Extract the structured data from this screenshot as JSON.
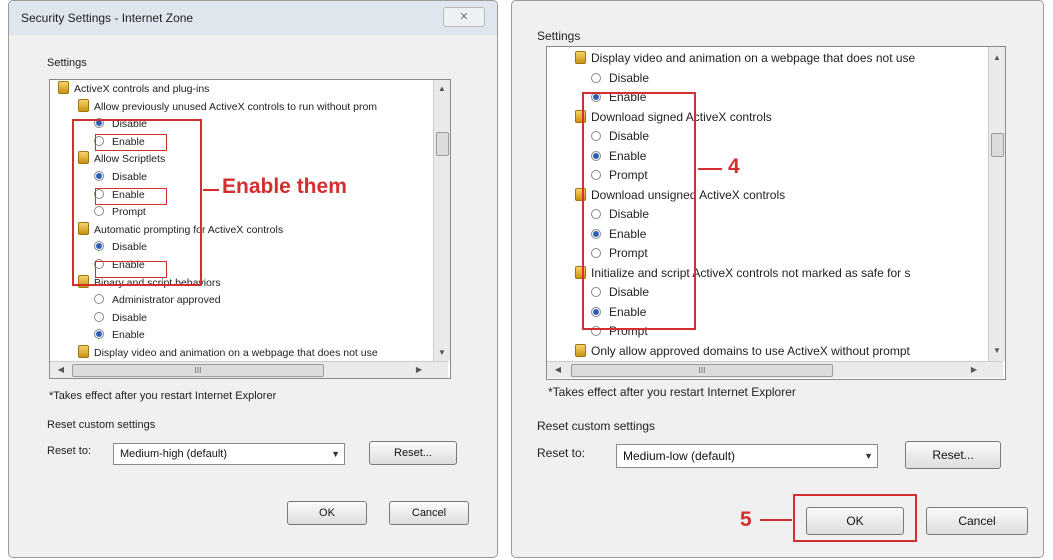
{
  "left_dialog": {
    "title": "Security Settings - Internet Zone",
    "close_glyph": "✕",
    "settings_label": "Settings",
    "items": [
      {
        "kind": "header",
        "text": "ActiveX controls and plug-ins"
      },
      {
        "kind": "item",
        "text": "Allow previously unused ActiveX controls to run without prom"
      },
      {
        "kind": "opt",
        "text": "Disable",
        "selected": true
      },
      {
        "kind": "opt",
        "text": "Enable",
        "selected": false
      },
      {
        "kind": "item",
        "text": "Allow Scriptlets"
      },
      {
        "kind": "opt",
        "text": "Disable",
        "selected": true
      },
      {
        "kind": "opt",
        "text": "Enable",
        "selected": false
      },
      {
        "kind": "opt",
        "text": "Prompt",
        "selected": false
      },
      {
        "kind": "item",
        "text": "Automatic prompting for ActiveX controls"
      },
      {
        "kind": "opt",
        "text": "Disable",
        "selected": true
      },
      {
        "kind": "opt",
        "text": "Enable",
        "selected": false
      },
      {
        "kind": "item",
        "text": "Binary and script behaviors"
      },
      {
        "kind": "opt",
        "text": "Administrator approved",
        "selected": false
      },
      {
        "kind": "opt",
        "text": "Disable",
        "selected": false
      },
      {
        "kind": "opt",
        "text": "Enable",
        "selected": true
      },
      {
        "kind": "item",
        "text": "Display video and animation on a webpage that does not use"
      }
    ],
    "hscroll_grip": "III",
    "note": "*Takes effect after you restart Internet Explorer",
    "reset_group": "Reset custom settings",
    "reset_to_label": "Reset to:",
    "reset_value": "Medium-high (default)",
    "reset_button": "Reset...",
    "ok_button": "OK",
    "cancel_button": "Cancel"
  },
  "right_dialog": {
    "settings_label": "Settings",
    "items": [
      {
        "kind": "item",
        "text": "Display video and animation on a webpage that does not use"
      },
      {
        "kind": "opt",
        "text": "Disable",
        "selected": false
      },
      {
        "kind": "opt",
        "text": "Enable",
        "selected": true
      },
      {
        "kind": "item",
        "text": "Download signed ActiveX controls"
      },
      {
        "kind": "opt",
        "text": "Disable",
        "selected": false
      },
      {
        "kind": "opt",
        "text": "Enable",
        "selected": true
      },
      {
        "kind": "opt",
        "text": "Prompt",
        "selected": false
      },
      {
        "kind": "item",
        "text": "Download unsigned ActiveX controls"
      },
      {
        "kind": "opt",
        "text": "Disable",
        "selected": false
      },
      {
        "kind": "opt",
        "text": "Enable",
        "selected": true
      },
      {
        "kind": "opt",
        "text": "Prompt",
        "selected": false
      },
      {
        "kind": "item",
        "text": "Initialize and script ActiveX controls not marked as safe for s"
      },
      {
        "kind": "opt",
        "text": "Disable",
        "selected": false
      },
      {
        "kind": "opt",
        "text": "Enable",
        "selected": true
      },
      {
        "kind": "opt",
        "text": "Prompt",
        "selected": false
      },
      {
        "kind": "item",
        "text": "Only allow approved domains to use ActiveX without prompt"
      }
    ],
    "hscroll_grip": "III",
    "note": "*Takes effect after you restart Internet Explorer",
    "reset_group": "Reset custom settings",
    "reset_to_label": "Reset to:",
    "reset_value": "Medium-low (default)",
    "reset_button": "Reset...",
    "ok_button": "OK",
    "cancel_button": "Cancel"
  },
  "annotations": {
    "enable_them": "Enable them",
    "step4": "4",
    "step5": "5",
    "color": "#d32f2f"
  }
}
